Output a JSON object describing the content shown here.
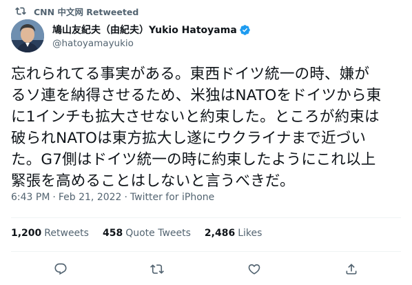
{
  "retweet": {
    "label": "CNN 中文网 Retweeted",
    "icon": "retweet-icon"
  },
  "author": {
    "display_name": "鳩山友紀夫（由紀夫）Yukio Hatoyama",
    "handle": "@hatoyamayukio",
    "verified": true
  },
  "tweet": {
    "lines": [
      "忘れられてる事実がある。東西ドイツ統一の時、嫌が",
      "るソ連を納得させるため、米独はNATOをドイツから東",
      "に1インチも拡大させないと約束した。ところが約束は",
      "破られNATOは東方拡大し遂にウクライナまで近づい",
      "た。G7側はドイツ統一の時に約束したようにこれ以上",
      "緊張を高めることはしないと言うべきだ。"
    ]
  },
  "meta": {
    "time": "6:43 PM",
    "separator": "·",
    "date": "Feb 21, 2022",
    "source": "Twitter for iPhone"
  },
  "stats": {
    "retweets_count": "1,200",
    "retweets_label": "Retweets",
    "quotes_count": "458",
    "quotes_label": "Quote Tweets",
    "likes_count": "2,486",
    "likes_label": "Likes"
  },
  "actions": [
    "reply-icon",
    "retweet-icon",
    "like-icon",
    "share-icon"
  ],
  "colors": {
    "accent": "#1d9bf0",
    "secondary_text": "#536471",
    "primary_text": "#0f1419",
    "divider": "#eff3f4"
  }
}
